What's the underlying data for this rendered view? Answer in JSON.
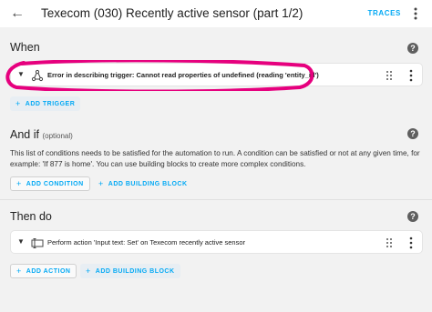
{
  "header": {
    "title": "Texecom (030) Recently active sensor (part 1/2)",
    "traces_label": "TRACES"
  },
  "when": {
    "heading": "When",
    "trigger_text": "Error in describing trigger: Cannot read properties of undefined (reading 'entity_id')",
    "add_trigger_label": "ADD TRIGGER"
  },
  "and_if": {
    "heading": "And if",
    "optional_label": "(optional)",
    "description": "This list of conditions needs to be satisfied for the automation to run. A condition can be satisfied or not at any given time, for example: 'If 877 is home'. You can use building blocks to create more complex conditions.",
    "add_condition_label": "ADD CONDITION",
    "add_building_block_label": "ADD BUILDING BLOCK"
  },
  "then_do": {
    "heading": "Then do",
    "action_text": "Perform action 'Input text: Set' on Texecom recently active sensor",
    "add_action_label": "ADD ACTION",
    "add_building_block_label": "ADD BUILDING BLOCK"
  },
  "colors": {
    "accent": "#03a9f4",
    "annotation": "#e6007e"
  },
  "icons": {
    "back": "arrow-left-icon",
    "menu": "dots-vertical-icon",
    "help": "help-circle-icon",
    "trigger": "trigger-graph-icon",
    "action": "input-text-icon",
    "drag": "drag-handle-icon",
    "expand": "chevron-down-icon",
    "add": "plus-icon"
  }
}
